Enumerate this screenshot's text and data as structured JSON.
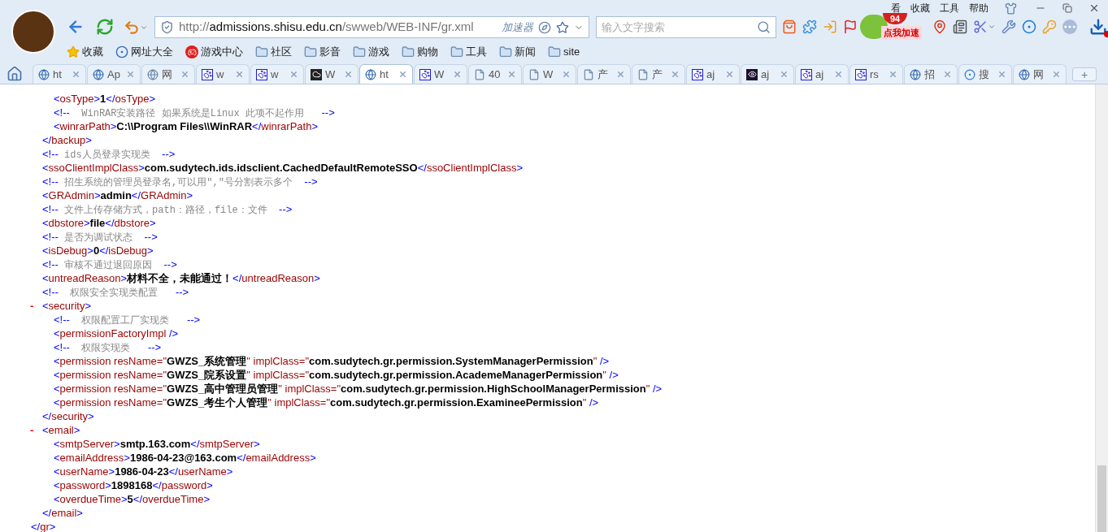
{
  "menu": [
    "看",
    "收藏",
    "工具",
    "帮助"
  ],
  "badge": {
    "count": "94",
    "boost_label": "点我加速"
  },
  "address_bar": {
    "scheme": "http://",
    "host": "admissions.shisu.edu.cn",
    "path": "/swweb/WEB-INF/gr.xml",
    "accelerator_label": "加速器"
  },
  "search": {
    "placeholder": "输入文字搜索"
  },
  "bookmarks": [
    {
      "label": "收藏",
      "kind": "star"
    },
    {
      "label": "网址大全",
      "kind": "sogou"
    },
    {
      "label": "游戏中心",
      "kind": "game"
    },
    {
      "label": "社区",
      "kind": "folder"
    },
    {
      "label": "影音",
      "kind": "folder"
    },
    {
      "label": "游戏",
      "kind": "folder"
    },
    {
      "label": "购物",
      "kind": "folder"
    },
    {
      "label": "工具",
      "kind": "folder"
    },
    {
      "label": "新闻",
      "kind": "folder"
    },
    {
      "label": "site",
      "kind": "folder"
    }
  ],
  "tabs": [
    {
      "title": "ht",
      "kind": "seal",
      "selected": false
    },
    {
      "title": "Ap",
      "kind": "seal",
      "selected": false
    },
    {
      "title": "网",
      "kind": "globe",
      "selected": false
    },
    {
      "title": "w",
      "kind": "paw",
      "selected": false
    },
    {
      "title": "w",
      "kind": "paw",
      "selected": false
    },
    {
      "title": "W",
      "kind": "cloud",
      "selected": false
    },
    {
      "title": "ht",
      "kind": "seal",
      "selected": true
    },
    {
      "title": "W",
      "kind": "paw",
      "selected": false
    },
    {
      "title": "40",
      "kind": "page",
      "selected": false
    },
    {
      "title": "W",
      "kind": "page",
      "selected": false
    },
    {
      "title": "产",
      "kind": "page",
      "selected": false
    },
    {
      "title": "产",
      "kind": "page",
      "selected": false
    },
    {
      "title": "aj",
      "kind": "paw",
      "selected": false
    },
    {
      "title": "aj",
      "kind": "eye",
      "selected": false
    },
    {
      "title": "aj",
      "kind": "paw",
      "selected": false
    },
    {
      "title": "rs",
      "kind": "paw",
      "selected": false
    },
    {
      "title": "招",
      "kind": "seal",
      "selected": false
    },
    {
      "title": "搜",
      "kind": "sogou",
      "selected": false
    },
    {
      "title": "网",
      "kind": "seal",
      "selected": false
    }
  ],
  "new_tab": "+",
  "xml": {
    "close": "</gr>",
    "children": [
      {
        "kind": "container",
        "close": "</backup>",
        "children": [
          {
            "kind": "element",
            "open": "<osType>",
            "value": "1",
            "close": "</osType>"
          },
          {
            "kind": "comment",
            "text": "<!--  WinRAR安装路径 如果系统是Linux 此项不起作用   -->"
          },
          {
            "kind": "element",
            "open": "<winrarPath>",
            "value": "C:\\\\Program Files\\\\WinRAR",
            "close": "</winrarPath>"
          }
        ]
      },
      {
        "kind": "comment",
        "text": "<!-- ids人员登录实现类  -->"
      },
      {
        "kind": "element",
        "open": "<ssoClientImplClass>",
        "value": "com.sudytech.ids.idsclient.CachedDefaultRemoteSSO",
        "close": "</ssoClientImplClass>"
      },
      {
        "kind": "comment",
        "text": "<!-- 招生系统的管理员登录名,可以用\",\"号分割表示多个  -->"
      },
      {
        "kind": "element",
        "open": "<GRAdmin>",
        "value": "admin",
        "close": "</GRAdmin>"
      },
      {
        "kind": "comment",
        "text": "<!-- 文件上传存储方式，path：路径，file：文件  -->"
      },
      {
        "kind": "element",
        "open": "<dbstore>",
        "value": "file",
        "close": "</dbstore>"
      },
      {
        "kind": "comment",
        "text": "<!-- 是否为调试状态  -->"
      },
      {
        "kind": "element",
        "open": "<isDebug>",
        "value": "0",
        "close": "</isDebug>"
      },
      {
        "kind": "comment",
        "text": "<!-- 审核不通过退回原因  -->"
      },
      {
        "kind": "element",
        "open": "<untreadReason>",
        "value": "材料不全，未能通过！",
        "close": "</untreadReason>"
      },
      {
        "kind": "comment",
        "text": "<!--  权限安全实现类配置   -->"
      },
      {
        "kind": "container",
        "toggle": "-",
        "open": "<security>",
        "close": "</security>",
        "children": [
          {
            "kind": "comment",
            "text": "<!--  权限配置工厂实现类   -->"
          },
          {
            "kind": "empty",
            "tag": "<permissionFactoryImpl",
            "end": "/>"
          },
          {
            "kind": "comment",
            "text": "<!--  权限实现类   -->"
          },
          {
            "kind": "empty",
            "tag": "<permission",
            "attributes": [
              "resName=\"GWZS_系统管理\"",
              "implClass=\"com.sudytech.gr.permission.SystemManagerPermission\""
            ],
            "end": "/>"
          },
          {
            "kind": "empty",
            "tag": "<permission",
            "attributes": [
              "resName=\"GWZS_院系设置\"",
              "implClass=\"com.sudytech.gr.permission.AcademeManagerPermission\""
            ],
            "end": "/>"
          },
          {
            "kind": "empty",
            "tag": "<permission",
            "attributes": [
              "resName=\"GWZS_高中管理员管理\"",
              "implClass=\"com.sudytech.gr.permission.HighSchoolManagerPermission\""
            ],
            "end": "/>"
          },
          {
            "kind": "empty",
            "tag": "<permission",
            "attributes": [
              "resName=\"GWZS_考生个人管理\"",
              "implClass=\"com.sudytech.gr.permission.ExamineePermission\""
            ],
            "end": "/>"
          }
        ]
      },
      {
        "kind": "container",
        "toggle": "-",
        "open": "<email>",
        "close": "</email>",
        "children": [
          {
            "kind": "element",
            "open": "<smtpServer>",
            "value": "smtp.163.com",
            "close": "</smtpServer>"
          },
          {
            "kind": "element",
            "open": "<emailAddress>",
            "value": "1986-04-23@163.com",
            "close": "</emailAddress>"
          },
          {
            "kind": "element",
            "open": "<userName>",
            "value": "1986-04-23",
            "close": "</userName>"
          },
          {
            "kind": "element",
            "open": "<password>",
            "value": "1898168",
            "close": "</password>"
          },
          {
            "kind": "element",
            "open": "<overdueTime>",
            "value": "5",
            "close": "</overdueTime>"
          }
        ]
      }
    ]
  }
}
